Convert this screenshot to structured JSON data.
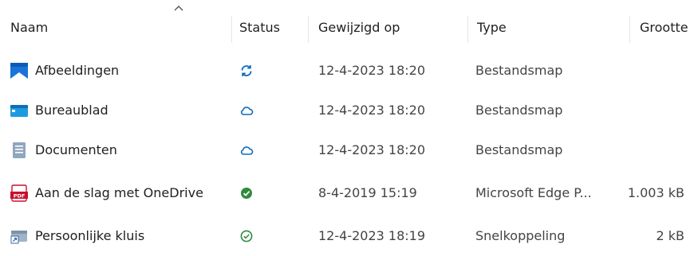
{
  "columns": {
    "name": "Naam",
    "status": "Status",
    "modified": "Gewijzigd op",
    "type": "Type",
    "size": "Grootte"
  },
  "sort": {
    "column": "name",
    "direction": "ascending",
    "icon": "chevron-up-icon"
  },
  "rows": [
    {
      "name": "Afbeeldingen",
      "icon": "pictures-folder-icon",
      "status_icon": "sync-icon",
      "modified": "12-4-2023 18:20",
      "type": "Bestandsmap",
      "size": ""
    },
    {
      "name": "Bureaublad",
      "icon": "desktop-folder-icon",
      "status_icon": "cloud-icon",
      "modified": "12-4-2023 18:20",
      "type": "Bestandsmap",
      "size": ""
    },
    {
      "name": "Documenten",
      "icon": "documents-folder-icon",
      "status_icon": "cloud-icon",
      "modified": "12-4-2023 18:20",
      "type": "Bestandsmap",
      "size": ""
    },
    {
      "name": "Aan de slag met OneDrive",
      "icon": "pdf-file-icon",
      "status_icon": "check-filled-icon",
      "modified": "8-4-2019 15:19",
      "type": "Microsoft Edge P...",
      "size": "1.003 kB"
    },
    {
      "name": "Persoonlijke kluis",
      "icon": "shortcut-icon",
      "status_icon": "check-outline-icon",
      "modified": "12-4-2023 18:19",
      "type": "Snelkoppeling",
      "size": "2 kB"
    }
  ],
  "colors": {
    "sync": "#0f6cbd",
    "cloud": "#0f6cbd",
    "check": "#2e8b3e",
    "pdf": "#c8102e"
  }
}
